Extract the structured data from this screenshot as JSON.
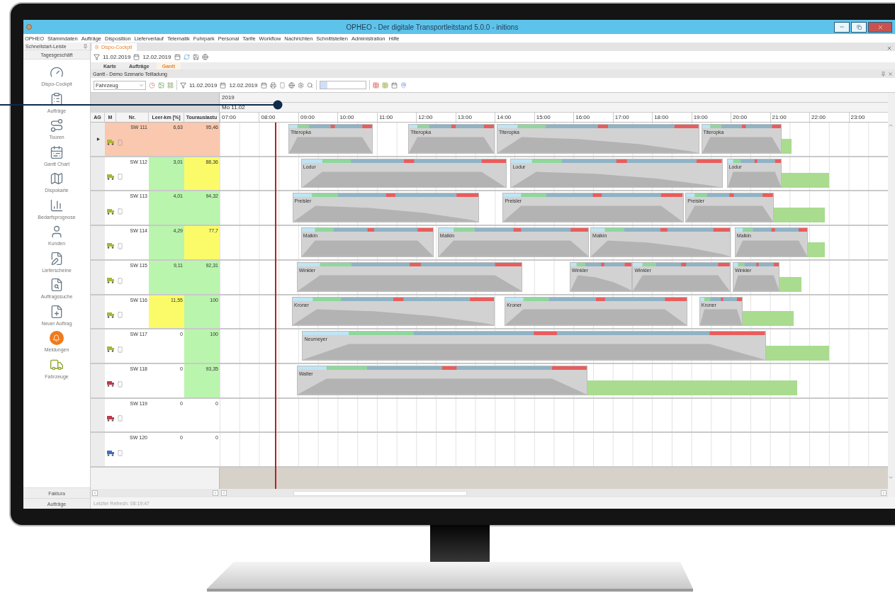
{
  "window": {
    "title": "OPHEO - Der digitale Transportleitstand 5.0.0  - initions"
  },
  "menu": [
    "OPHEO",
    "Stammdaten",
    "Aufträge",
    "Disposition",
    "Lieferverlauf",
    "Telematik",
    "Fuhrpark",
    "Personal",
    "Tarife",
    "Workflow",
    "Nachrichten",
    "Schnittstellen",
    "Administration",
    "Hilfe"
  ],
  "sidebar": {
    "title": "Schnellstart-Leiste",
    "group": "Tagesgeschäft",
    "items": [
      {
        "label": "Dispo-Cockpit",
        "kind": "gauge"
      },
      {
        "label": "Aufträge",
        "kind": "clipboard"
      },
      {
        "label": "Touren",
        "kind": "route"
      },
      {
        "label": "Gantt Chart",
        "kind": "gantt"
      },
      {
        "label": "Dispokarte",
        "kind": "map"
      },
      {
        "label": "Bedarfsprognose",
        "kind": "chart"
      },
      {
        "label": "Kunden",
        "kind": "person"
      },
      {
        "label": "Lieferscheine",
        "kind": "note"
      },
      {
        "label": "Auftragssuche",
        "kind": "search"
      },
      {
        "label": "Neuer Auftrag",
        "kind": "new"
      },
      {
        "label": "Meldungen",
        "kind": "alert"
      },
      {
        "label": "Fahrzeuge",
        "kind": "truck"
      }
    ],
    "bottom": [
      "Faktura",
      "Aufträge"
    ]
  },
  "document_tab": {
    "title": "Dispo-Cockpit"
  },
  "filter": {
    "from": "11.02.2019",
    "to": "12.02.2019"
  },
  "view_tabs": [
    {
      "label": "Karte",
      "selected": false
    },
    {
      "label": "Aufträge",
      "selected": false
    },
    {
      "label": "Gantt",
      "selected": true
    }
  ],
  "panel": {
    "title": "Gantt - Demo Szenario Teilladung",
    "group_by": "Fahrzeug",
    "from": "11.02.2019",
    "to": "12.02.2019"
  },
  "gantt": {
    "year": "2019",
    "day": "Mo 11.02",
    "hours": [
      "07:00",
      "08:00",
      "09:00",
      "10:00",
      "11:00",
      "12:00",
      "13:00",
      "14:00",
      "15:00",
      "16:00",
      "17:00",
      "18:00",
      "19:00",
      "20:00",
      "21:00",
      "22:00",
      "23:00"
    ],
    "columns": [
      "AG",
      "M",
      "Nr.",
      "Leer-km [%]",
      "Tourauslastu"
    ],
    "rows": [
      {
        "nr": "SW 111",
        "selected": true,
        "color": "#a8b832",
        "empty_km": {
          "text": "6,63"
        },
        "utilization": {
          "text": "95,46"
        },
        "tours": [
          {
            "driver": "Titeropka"
          },
          {
            "driver": "Titeropka"
          },
          {
            "driver": "Titeropka"
          },
          {
            "driver": "Titeropka"
          }
        ]
      },
      {
        "nr": "SW 112",
        "selected": false,
        "color": "#a8b832",
        "empty_km": {
          "text": "3,01",
          "color": "#b9f5ad"
        },
        "utilization": {
          "text": "88,36",
          "color": "#fbfb6a"
        },
        "tours": [
          {
            "driver": "Lodur"
          },
          {
            "driver": "Lodur"
          },
          {
            "driver": "Lodur"
          }
        ]
      },
      {
        "nr": "SW 113",
        "selected": false,
        "color": "#a8b832",
        "empty_km": {
          "text": "4,01",
          "color": "#b9f5ad"
        },
        "utilization": {
          "text": "94,32",
          "color": "#b9f5ad"
        },
        "tours": [
          {
            "driver": "Preisler"
          },
          {
            "driver": "Preisler"
          },
          {
            "driver": "Preisler"
          }
        ]
      },
      {
        "nr": "SW 114",
        "selected": false,
        "color": "#a8b832",
        "empty_km": {
          "text": "4,29",
          "color": "#b9f5ad"
        },
        "utilization": {
          "text": "77,7",
          "color": "#fbfb6a"
        },
        "tours": [
          {
            "driver": "Malkin"
          },
          {
            "driver": "Malkin"
          },
          {
            "driver": "Malkin"
          },
          {
            "driver": "Malkin"
          }
        ]
      },
      {
        "nr": "SW 115",
        "selected": false,
        "color": "#a8b832",
        "empty_km": {
          "text": "9,11",
          "color": "#b9f5ad"
        },
        "utilization": {
          "text": "92,31",
          "color": "#b9f5ad"
        },
        "tours": [
          {
            "driver": "Winkler"
          },
          {
            "driver": "Winkler"
          },
          {
            "driver": "Winkler"
          },
          {
            "driver": "Winkler"
          }
        ]
      },
      {
        "nr": "SW 116",
        "selected": false,
        "color": "#a8b832",
        "empty_km": {
          "text": "11,55",
          "color": "#fbfb6a"
        },
        "utilization": {
          "text": "100",
          "color": "#b9f5ad"
        },
        "tours": [
          {
            "driver": "Kroner"
          },
          {
            "driver": "Kroner"
          },
          {
            "driver": "Kroner"
          }
        ]
      },
      {
        "nr": "SW 117",
        "selected": false,
        "color": "#a8b832",
        "empty_km": {
          "text": "0"
        },
        "utilization": {
          "text": "100",
          "color": "#b9f5ad"
        },
        "tours": [
          {
            "driver": "Neumeyer"
          }
        ]
      },
      {
        "nr": "SW 118",
        "selected": false,
        "color": "#c0394b",
        "empty_km": {
          "text": "0"
        },
        "utilization": {
          "text": "93,35",
          "color": "#b9f5ad"
        },
        "tours": [
          {
            "driver": "Walter"
          }
        ]
      },
      {
        "nr": "SW 119",
        "selected": false,
        "color": "#c0394b",
        "empty_km": {
          "text": "0"
        },
        "utilization": {
          "text": "0"
        },
        "tours": []
      },
      {
        "nr": "SW 120",
        "selected": false,
        "color": "#3a6fc4",
        "empty_km": {
          "text": "0"
        },
        "utilization": {
          "text": "0"
        },
        "tours": []
      }
    ]
  },
  "status_bar": {
    "text": "Letzter Refresh: 08:19:47"
  }
}
